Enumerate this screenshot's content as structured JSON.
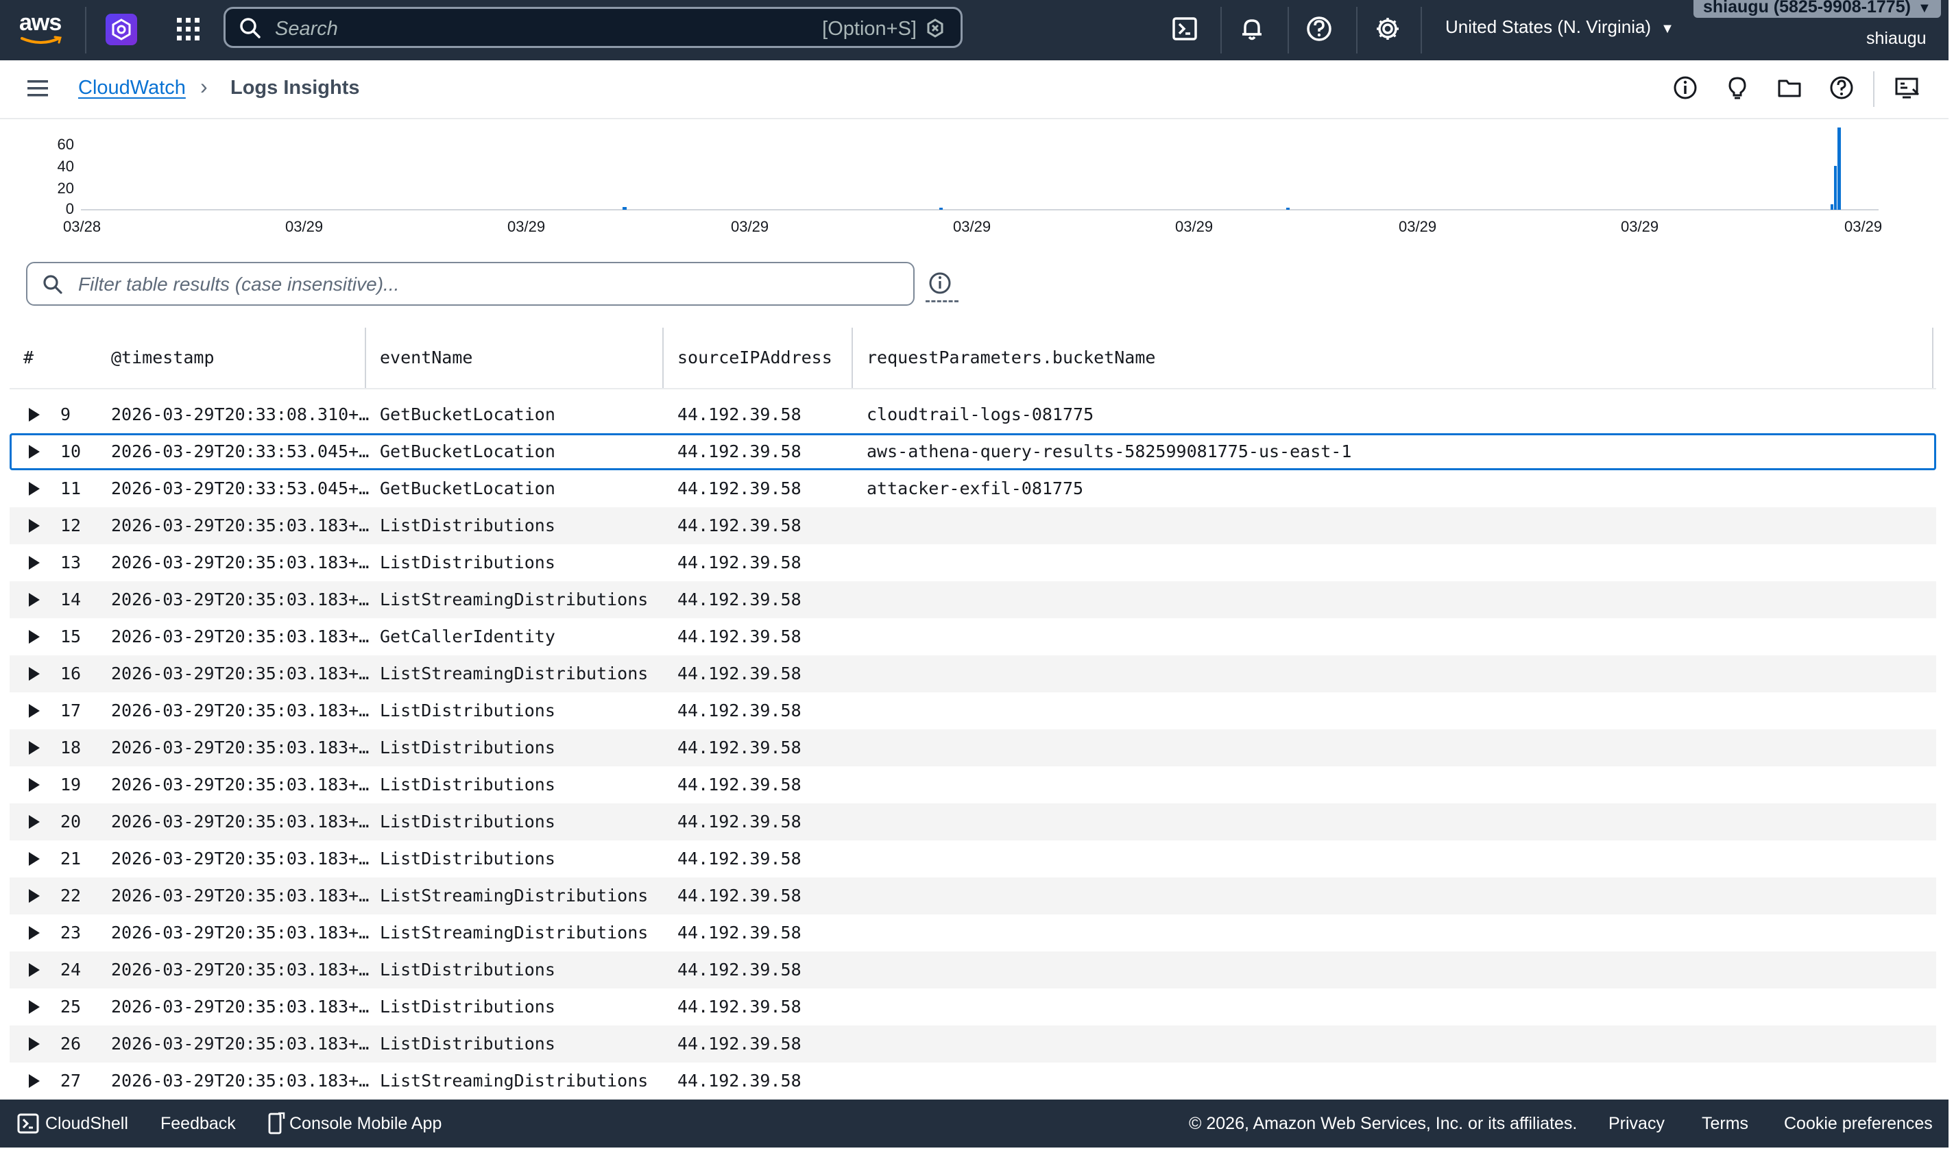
{
  "topnav": {
    "logo_text": "aws",
    "search_placeholder": "Search",
    "search_shortcut": "[Option+S]",
    "region": "United States (N. Virginia)",
    "account": "shiaugu (5825-9908-1775)",
    "username": "shiaugu",
    "icons": [
      "service-icon",
      "apps-grid-icon",
      "cloudshell-icon",
      "bell-icon",
      "help-icon",
      "gear-icon"
    ]
  },
  "breadcrumb": {
    "parent": "CloudWatch",
    "current": "Logs Insights"
  },
  "histogram": {
    "y_ticks": [
      "60",
      "40",
      "20",
      "0"
    ],
    "x_ticks": [
      "03/28",
      "03/29",
      "03/29",
      "03/29",
      "03/29",
      "03/29",
      "03/29",
      "03/29",
      "03/29"
    ],
    "bar_color": "#0972d3"
  },
  "filter": {
    "placeholder": "Filter table results (case insensitive)..."
  },
  "table": {
    "columns": [
      "#",
      "@timestamp",
      "eventName",
      "sourceIPAddress",
      "requestParameters.bucketName"
    ],
    "rows": [
      {
        "n": "9",
        "ts": "2026-03-29T20:33:08.310+…",
        "event": "GetBucketLocation",
        "ip": "44.192.39.58",
        "bucket": "cloudtrail-logs-081775"
      },
      {
        "n": "10",
        "ts": "2026-03-29T20:33:53.045+…",
        "event": "GetBucketLocation",
        "ip": "44.192.39.58",
        "bucket": "aws-athena-query-results-582599081775-us-east-1"
      },
      {
        "n": "11",
        "ts": "2026-03-29T20:33:53.045+…",
        "event": "GetBucketLocation",
        "ip": "44.192.39.58",
        "bucket": "attacker-exfil-081775"
      },
      {
        "n": "12",
        "ts": "2026-03-29T20:35:03.183+…",
        "event": "ListDistributions",
        "ip": "44.192.39.58",
        "bucket": ""
      },
      {
        "n": "13",
        "ts": "2026-03-29T20:35:03.183+…",
        "event": "ListDistributions",
        "ip": "44.192.39.58",
        "bucket": ""
      },
      {
        "n": "14",
        "ts": "2026-03-29T20:35:03.183+…",
        "event": "ListStreamingDistributions",
        "ip": "44.192.39.58",
        "bucket": ""
      },
      {
        "n": "15",
        "ts": "2026-03-29T20:35:03.183+…",
        "event": "GetCallerIdentity",
        "ip": "44.192.39.58",
        "bucket": ""
      },
      {
        "n": "16",
        "ts": "2026-03-29T20:35:03.183+…",
        "event": "ListStreamingDistributions",
        "ip": "44.192.39.58",
        "bucket": ""
      },
      {
        "n": "17",
        "ts": "2026-03-29T20:35:03.183+…",
        "event": "ListDistributions",
        "ip": "44.192.39.58",
        "bucket": ""
      },
      {
        "n": "18",
        "ts": "2026-03-29T20:35:03.183+…",
        "event": "ListDistributions",
        "ip": "44.192.39.58",
        "bucket": ""
      },
      {
        "n": "19",
        "ts": "2026-03-29T20:35:03.183+…",
        "event": "ListDistributions",
        "ip": "44.192.39.58",
        "bucket": ""
      },
      {
        "n": "20",
        "ts": "2026-03-29T20:35:03.183+…",
        "event": "ListDistributions",
        "ip": "44.192.39.58",
        "bucket": ""
      },
      {
        "n": "21",
        "ts": "2026-03-29T20:35:03.183+…",
        "event": "ListDistributions",
        "ip": "44.192.39.58",
        "bucket": ""
      },
      {
        "n": "22",
        "ts": "2026-03-29T20:35:03.183+…",
        "event": "ListStreamingDistributions",
        "ip": "44.192.39.58",
        "bucket": ""
      },
      {
        "n": "23",
        "ts": "2026-03-29T20:35:03.183+…",
        "event": "ListStreamingDistributions",
        "ip": "44.192.39.58",
        "bucket": ""
      },
      {
        "n": "24",
        "ts": "2026-03-29T20:35:03.183+…",
        "event": "ListDistributions",
        "ip": "44.192.39.58",
        "bucket": ""
      },
      {
        "n": "25",
        "ts": "2026-03-29T20:35:03.183+…",
        "event": "ListDistributions",
        "ip": "44.192.39.58",
        "bucket": ""
      },
      {
        "n": "26",
        "ts": "2026-03-29T20:35:03.183+…",
        "event": "ListDistributions",
        "ip": "44.192.39.58",
        "bucket": ""
      },
      {
        "n": "27",
        "ts": "2026-03-29T20:35:03.183+…",
        "event": "ListStreamingDistributions",
        "ip": "44.192.39.58",
        "bucket": ""
      }
    ],
    "selected_row": "10"
  },
  "footer": {
    "cloudshell": "CloudShell",
    "feedback": "Feedback",
    "mobile_app": "Console Mobile App",
    "copyright": "© 2026, Amazon Web Services, Inc. or its affiliates.",
    "privacy": "Privacy",
    "terms": "Terms",
    "cookies": "Cookie preferences"
  },
  "colors": {
    "nav_bg": "#232f3e",
    "link": "#0972d3",
    "selected_outline": "#0972d3"
  }
}
